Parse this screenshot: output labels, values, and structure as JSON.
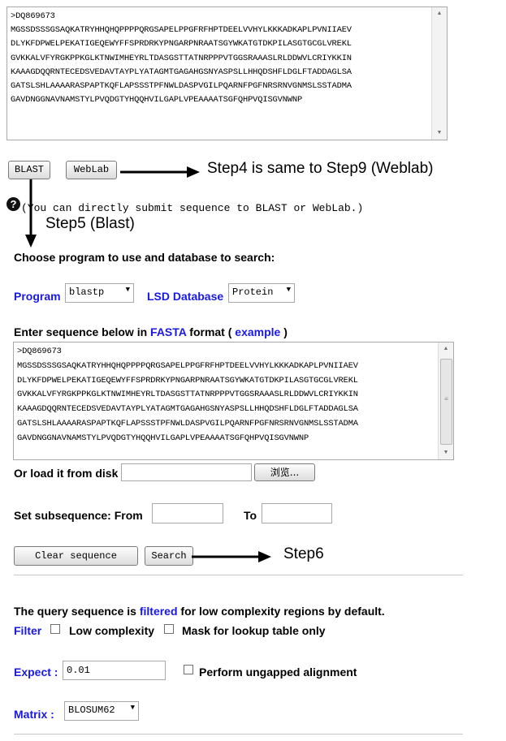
{
  "top_sequence": {
    "text": ">DQ869673\nMGSSDSSSGSAQKATRYHHQHQPPPPQRGSAPELPPGFRFHPTDEELVVHYLKKKADKAPLPVNIIAEV\nDLYKFDPWELPEKATIGEQEWYFFSPRDRKYPNGARPNRAATSGYWKATGTDKPILASGTGCGLVREKL\nGVKKALVFYRGKPPKGLKTNWIMHEYRLTDASGSTTATNRPPPVTGGSRAAASLRLDDWVLCRIYKKIN\nKAAAGDQQRNTECEDSVEDAVTAYPLYATAGMTGAGAHGSNYASPSLLHHQDSHFLDGLFTADDAGLSA\nGATSLSHLAAAARASPAPTKQFLAPSSSTPFNWLDASPVGILPQARNFPGFNRSRNVGNMSLSSTADMA\nGAVDNGGNAVNAMSTYLPVQDGTYHQQHVILGAPLVPEAAAATSGFQHPVQISGVNWNP"
  },
  "buttons": {
    "blast": "BLAST",
    "weblab": "WebLab",
    "clear": "Clear sequence",
    "search": "Search",
    "browse": "浏览..."
  },
  "annotations": {
    "step4": "Step4 is same to Step9 (Weblab)",
    "step5": "Step5 (Blast)",
    "step6": "Step6"
  },
  "help_text": "(You can directly submit sequence to BLAST or WebLab.)",
  "form": {
    "choose_label": "Choose program to use and database to search:",
    "program_label": "Program",
    "program_value": "blastp",
    "database_label": "LSD Database",
    "database_value": "Protein",
    "enter_prefix": "Enter sequence below in ",
    "fasta": "FASTA",
    "format_word": " format ( ",
    "example": "example",
    "close_paren": " )",
    "sequence": ">DQ869673\nMGSSDSSSGSAQKATRYHHQHQPPPPQRGSAPELPPGFRFHPTDEELVVHYLKKKADKAPLPVNIIAEV\nDLYKFDPWELPEKATIGEQEWYFFSPRDRKYPNGARPNRAATSGYWKATGTDKPILASGTGCGLVREKL\nGVKKALVFYRGKPPKGLKTNWIMHEYRLTDASGSTTATNRPPPVTGGSRAAASLRLDDWVLCRIYKKIN\nKAAAGDQQRNTECEDSVEDAVTAYPLYATAGMTGAGAHGSNYASPSLLHHQDSHFLDGLFTADDAGLSA\nGATSLSHLAAAARASPAPTKQFLAPSSSTPFNWLDASPVGILPQARNFPGFNRSRNVGNMSLSSTADMA\nGAVDNGGNAVNAMSTYLPVQDGTYHQQHVILGAPLVPEAAAATSGFQHPVQISGVNWNP",
    "load_label": "Or load it from disk",
    "subseq_label": "Set subsequence: From",
    "to_label": "To",
    "query_prefix": "The query sequence is ",
    "filtered": "filtered",
    "query_suffix": " for low complexity regions by default.",
    "filter_label": "Filter",
    "low_complexity": "Low complexity",
    "mask_lookup": "Mask for lookup table only",
    "expect_label": "Expect :",
    "expect_value": "0.01",
    "ungapped": "Perform ungapped alignment",
    "matrix_label": "Matrix :",
    "matrix_value": "BLOSUM62"
  },
  "colors": {
    "link_blue": "#1a1adf"
  }
}
